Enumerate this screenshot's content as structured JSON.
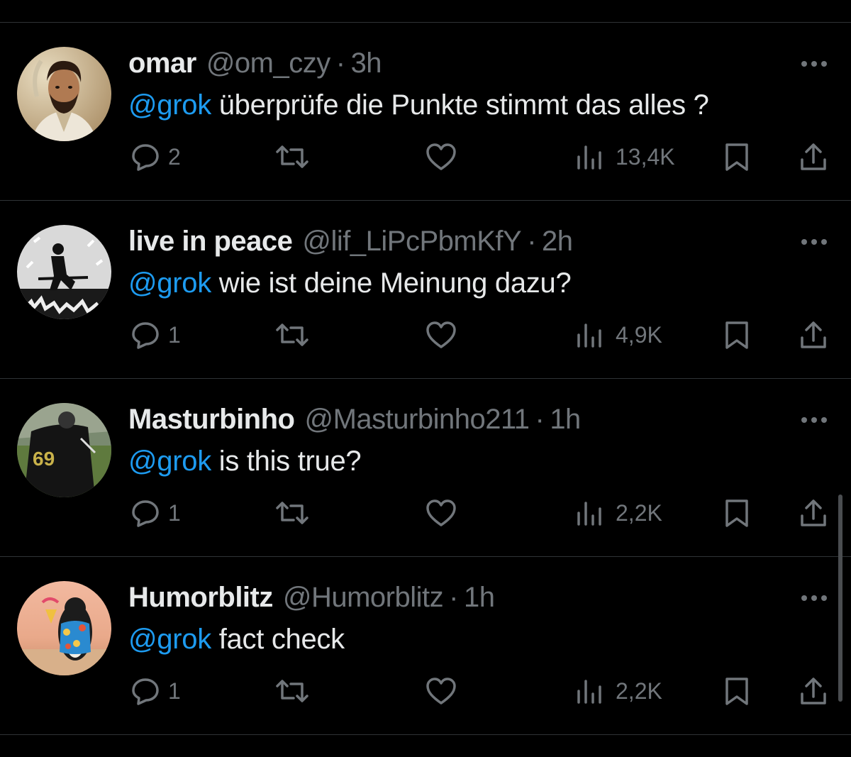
{
  "tweets": [
    {
      "display_name": "omar",
      "handle": "@om_czy",
      "separator": "·",
      "time": "3h",
      "mention": "@grok",
      "text": " überprüfe die Punkte stimmt das alles ?",
      "replies": "2",
      "views": "13,4K",
      "avatar": "avatar-bearded-man"
    },
    {
      "display_name": "live in peace",
      "handle": "@lif_LiPcPbmKfY",
      "separator": "·",
      "time": "2h",
      "mention": "@grok",
      "text": " wie ist deine Meinung dazu?",
      "replies": "1",
      "views": "4,9K",
      "avatar": "avatar-soldier-silhouette"
    },
    {
      "display_name": "Masturbinho",
      "handle": "@Masturbinho211",
      "separator": "·",
      "time": "1h",
      "mention": "@grok",
      "text": " is this true?",
      "replies": "1",
      "views": "2,2K",
      "avatar": "avatar-jersey-69"
    },
    {
      "display_name": "Humorblitz",
      "handle": "@Humorblitz",
      "separator": "·",
      "time": "1h",
      "mention": "@grok",
      "text": " fact check",
      "replies": "1",
      "views": "2,2K",
      "avatar": "avatar-penguin-beach"
    }
  ],
  "avatar_jersey_number": "69",
  "icons": {
    "reply": "reply-icon",
    "retweet": "retweet-icon",
    "like": "like-icon",
    "views": "views-icon",
    "bookmark": "bookmark-icon",
    "share": "share-icon",
    "more": "more-icon"
  },
  "colors": {
    "background": "#000000",
    "text": "#e7e9ea",
    "secondary": "#71767b",
    "mention": "#1d9bf0",
    "divider": "#2f3336"
  }
}
